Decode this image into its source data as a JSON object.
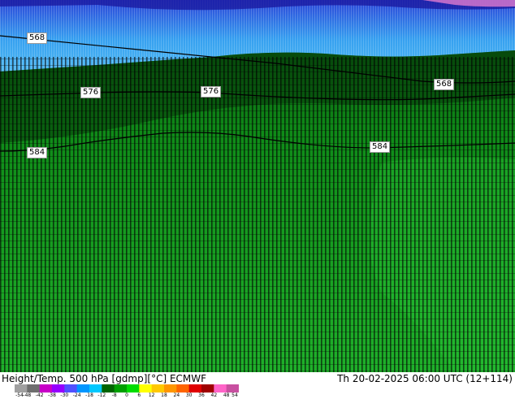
{
  "map": {
    "contour_labels": [
      {
        "text": "568"
      },
      {
        "text": "576"
      },
      {
        "text": "576"
      },
      {
        "text": "568"
      },
      {
        "text": "584"
      },
      {
        "text": "584"
      }
    ]
  },
  "footer": {
    "left_title": "Height/Temp. 500 hPa [gdmp][°C] ECMWF",
    "right_title": "Th 20-02-2025 06:00 UTC (12+114)"
  },
  "legend": {
    "tick_labels": [
      "-54",
      "-48",
      "-42",
      "-38",
      "-30",
      "-24",
      "-18",
      "-12",
      "-8",
      "0",
      "6",
      "12",
      "18",
      "24",
      "30",
      "36",
      "42",
      "48",
      "54"
    ],
    "colors": [
      "#a0a0a0",
      "#6e6e6e",
      "#c800c8",
      "#9600ff",
      "#5050ff",
      "#0096ff",
      "#00c8ff",
      "#006400",
      "#00a000",
      "#00dc00",
      "#ffff00",
      "#ffc800",
      "#ff9600",
      "#ff6400",
      "#e00000",
      "#a00000",
      "#ff64c8",
      "#c850a0"
    ]
  }
}
